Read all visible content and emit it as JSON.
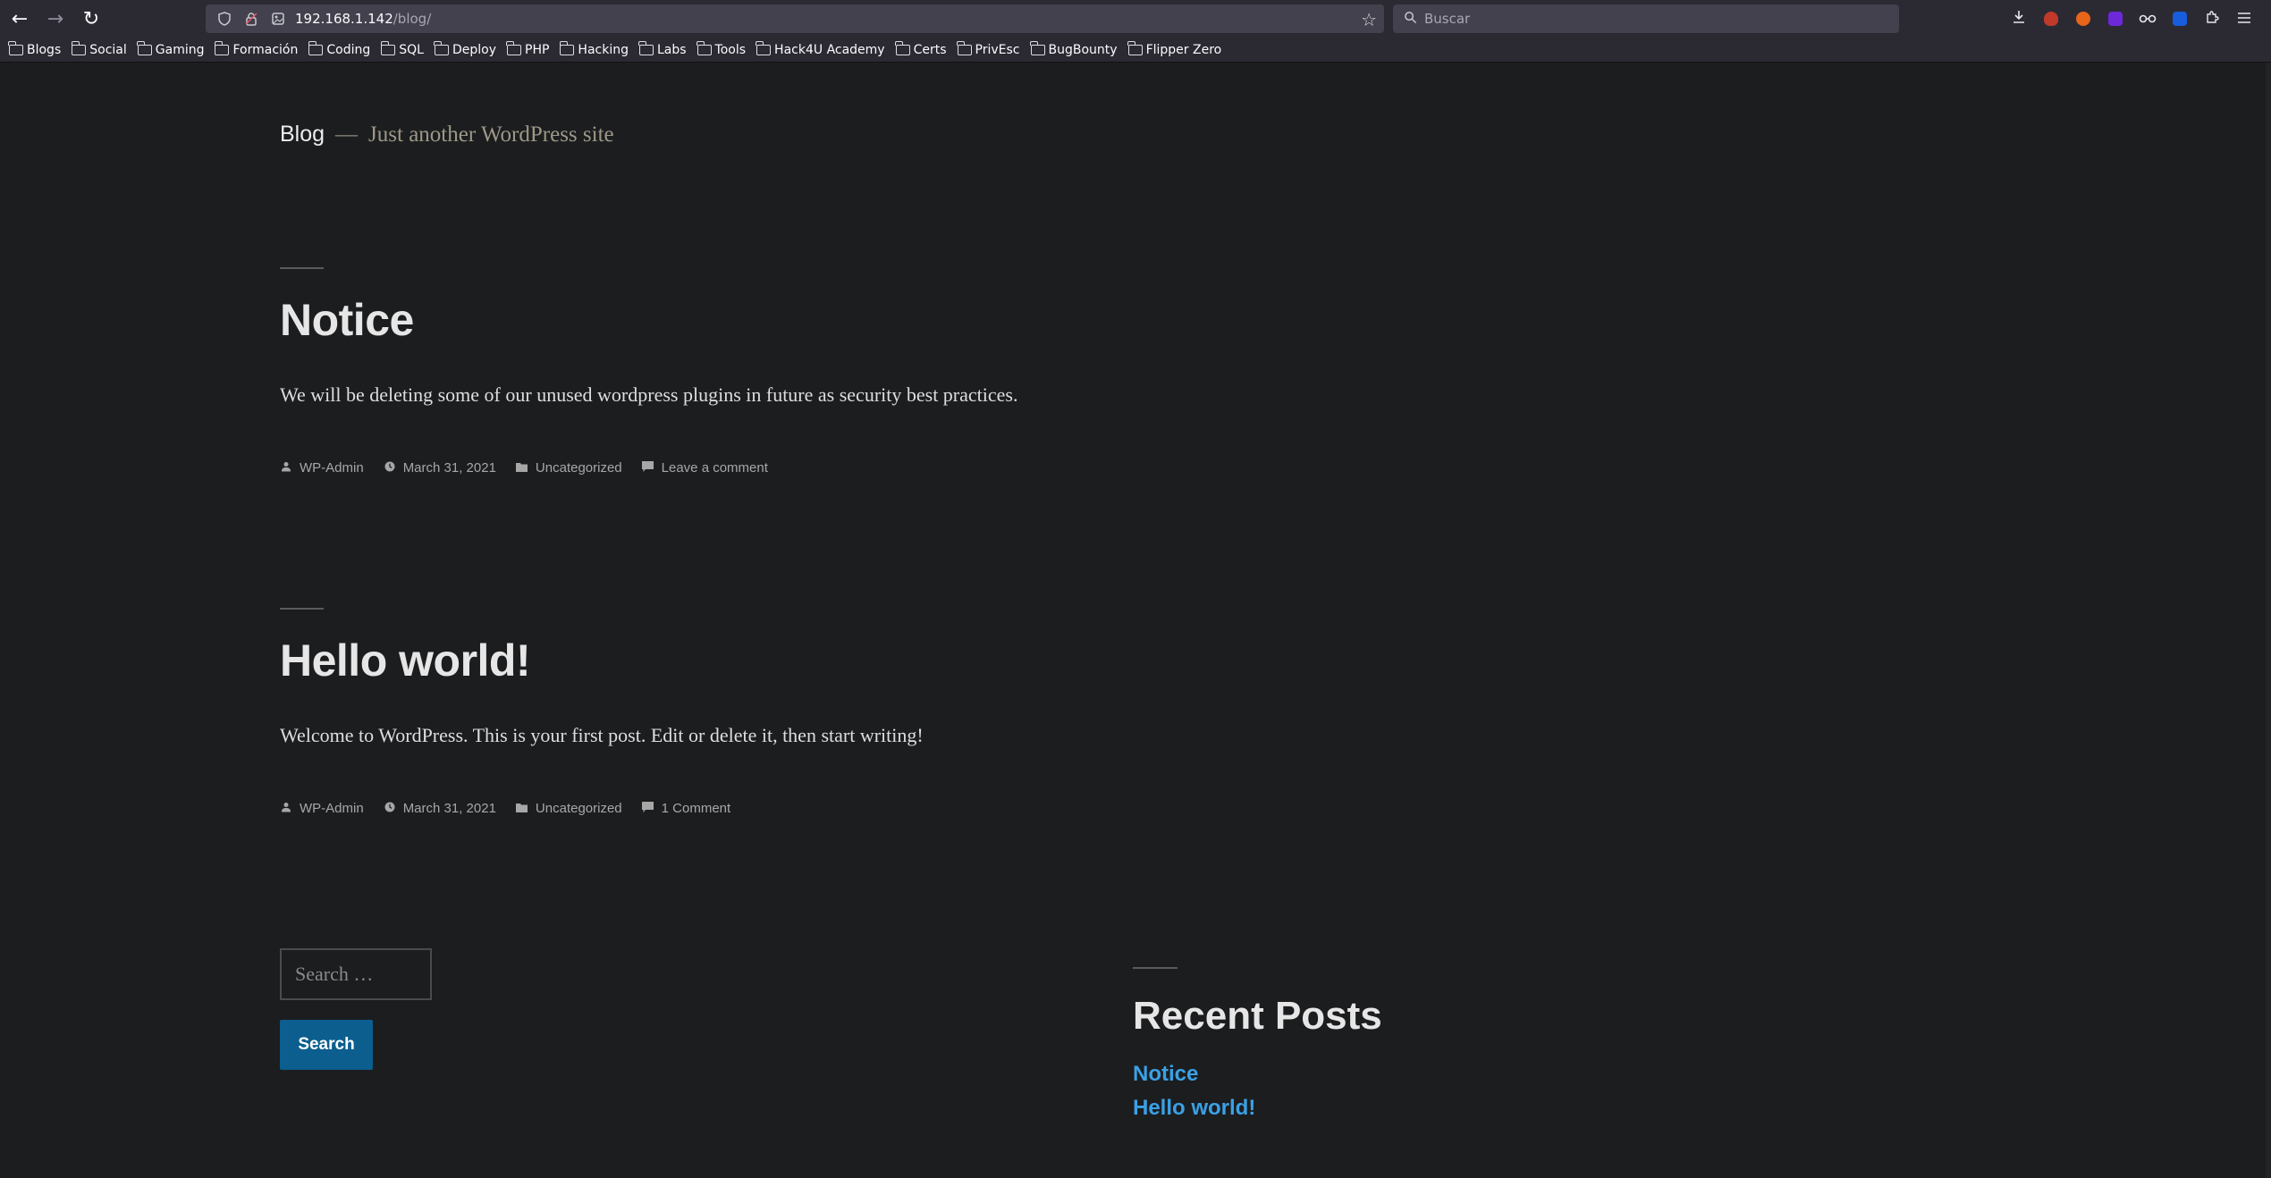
{
  "browser": {
    "nav": {
      "back_icon": "←",
      "forward_icon": "→",
      "reload_icon": "↻"
    },
    "url": {
      "host": "192.168.1.142",
      "path": "/blog/"
    },
    "search_placeholder": "Buscar",
    "bookmarks": [
      {
        "label": "Blogs"
      },
      {
        "label": "Social"
      },
      {
        "label": "Gaming"
      },
      {
        "label": "Formación"
      },
      {
        "label": "Coding"
      },
      {
        "label": "SQL"
      },
      {
        "label": "Deploy"
      },
      {
        "label": "PHP"
      },
      {
        "label": "Hacking"
      },
      {
        "label": "Labs"
      },
      {
        "label": "Tools"
      },
      {
        "label": "Hack4U Academy"
      },
      {
        "label": "Certs"
      },
      {
        "label": "PrivEsc"
      },
      {
        "label": "BugBounty"
      },
      {
        "label": "Flipper Zero"
      }
    ],
    "extension_colors": {
      "ublock": "#c0392b",
      "foxyproxy": "#e8651a",
      "wappalyzer": "#6d28d9",
      "bitwarden": "#175ddc"
    }
  },
  "site": {
    "title": "Blog",
    "separator": "—",
    "description": "Just another WordPress site"
  },
  "posts": [
    {
      "title": "Notice",
      "excerpt": "We will be deleting some of our unused wordpress plugins in future as security best practices.",
      "author": "WP-Admin",
      "date": "March 31, 2021",
      "category": "Uncategorized",
      "comments": "Leave a comment"
    },
    {
      "title": "Hello world!",
      "excerpt": "Welcome to WordPress. This is your first post. Edit or delete it, then start writing!",
      "author": "WP-Admin",
      "date": "March 31, 2021",
      "category": "Uncategorized",
      "comments": "1 Comment"
    }
  ],
  "search_widget": {
    "placeholder": "Search …",
    "button_label": "Search"
  },
  "recent_posts": {
    "heading": "Recent Posts",
    "items": [
      "Notice",
      "Hello world!"
    ]
  }
}
